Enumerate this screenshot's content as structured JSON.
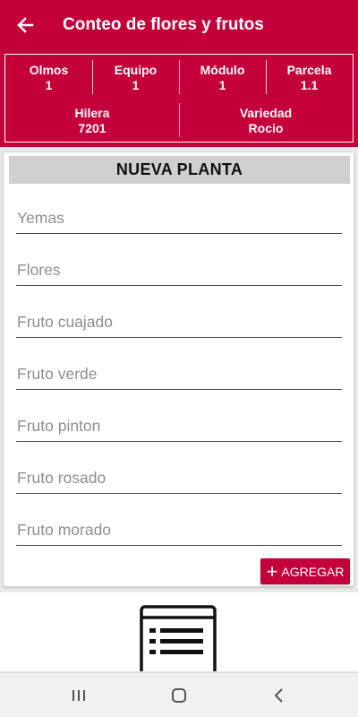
{
  "appbar": {
    "title": "Conteo de flores y frutos",
    "back_icon": "arrow-left-icon"
  },
  "info": {
    "row1": [
      {
        "label": "Olmos",
        "value": "1"
      },
      {
        "label": "Equipo",
        "value": "1"
      },
      {
        "label": "Módulo",
        "value": "1"
      },
      {
        "label": "Parcela",
        "value": "1.1"
      }
    ],
    "row2": [
      {
        "label": "Hilera",
        "value": "7201"
      },
      {
        "label": "Variedad",
        "value": "Rocio"
      }
    ]
  },
  "form": {
    "header": "NUEVA PLANTA",
    "fields": [
      {
        "placeholder": "Yemas",
        "value": ""
      },
      {
        "placeholder": "Flores",
        "value": ""
      },
      {
        "placeholder": "Fruto cuajado",
        "value": ""
      },
      {
        "placeholder": "Fruto verde",
        "value": ""
      },
      {
        "placeholder": "Fruto pinton",
        "value": ""
      },
      {
        "placeholder": "Fruto rosado",
        "value": ""
      },
      {
        "placeholder": "Fruto morado",
        "value": ""
      }
    ],
    "add_button": {
      "label": "AGREGAR",
      "icon": "plus-icon"
    }
  },
  "bottom": {
    "icon": "list-document-icon"
  },
  "navbar": {
    "icons": [
      "recent-apps-icon",
      "home-icon",
      "back-icon"
    ]
  },
  "colors": {
    "brand": "#c4003b",
    "header_bg": "#d0d0d0",
    "navbar_bg": "#f1f1f1"
  }
}
